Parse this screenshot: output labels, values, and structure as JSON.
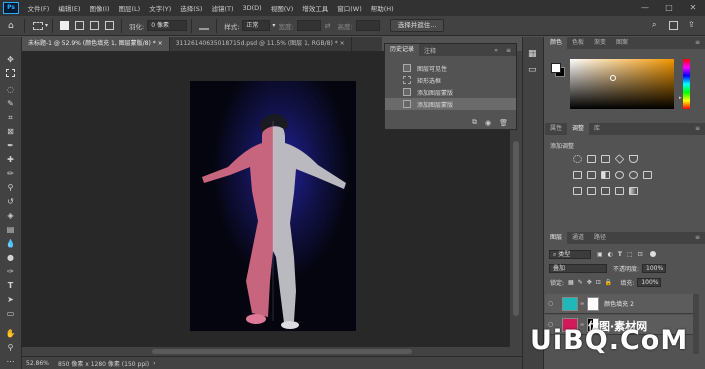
{
  "menubar": {
    "app_logo": "Ps",
    "items": [
      "文件(F)",
      "编辑(E)",
      "图像(I)",
      "图层(L)",
      "文字(Y)",
      "选择(S)",
      "滤镜(T)",
      "3D(D)",
      "视图(V)",
      "增效工具",
      "窗口(W)",
      "帮助(H)"
    ],
    "window_controls": [
      "—",
      "□",
      "✕"
    ]
  },
  "options": {
    "feather_label": "羽化:",
    "feather_value": "0 像素",
    "style_label": "样式:",
    "style_value": "正常",
    "width_label": "宽度:",
    "height_label": "高度:",
    "select_mask_button": "选择并遮住..."
  },
  "tabs": [
    {
      "label": "未标题-1 @ 52.9% (颜色填充 1, 图层蒙版/8) *",
      "close": "×"
    },
    {
      "label": "31126140635018715d.psd @ 11.5% (图层 1, RGB/8) *",
      "close": "×"
    }
  ],
  "status": {
    "zoom": "52.86%",
    "doc_info": "850 像素 x 1280 像素 (150 ppi)"
  },
  "history": {
    "tabs": [
      "历史记录",
      "注释"
    ],
    "items": [
      "图层可见性",
      "矩形选框",
      "添加图层蒙版",
      "添加图层蒙版"
    ],
    "selected_index": 3
  },
  "color_panel": {
    "tabs": [
      "颜色",
      "色板",
      "渐变",
      "图案"
    ],
    "foreground": "#ffffff",
    "background": "#000000",
    "hue_color": "#f29600"
  },
  "adjustments": {
    "tabs": [
      "属性",
      "调整",
      "库"
    ],
    "title": "添加调整"
  },
  "layers": {
    "tabs": [
      "图层",
      "通道",
      "路径"
    ],
    "filter_label": "类型",
    "blend_mode": "叠加",
    "opacity_label": "不透明度:",
    "opacity_value": "100%",
    "lock_label": "锁定:",
    "fill_label": "填充:",
    "fill_value": "100%",
    "items": [
      {
        "name": "颜色填充 2",
        "swatch": "#1fb8b8"
      },
      {
        "name": "",
        "swatch": "#d01a5a"
      }
    ]
  },
  "watermark": {
    "text": "UiBQ.CoM",
    "sub": "优图·素材网"
  }
}
